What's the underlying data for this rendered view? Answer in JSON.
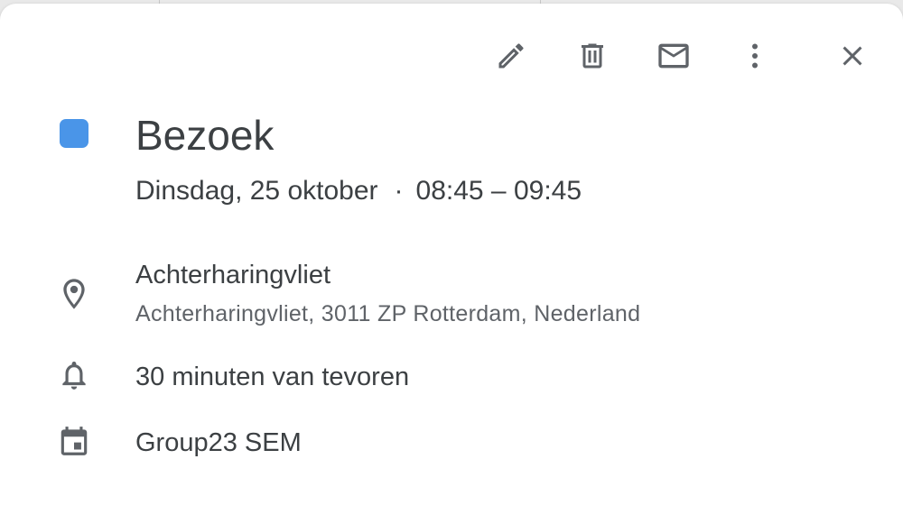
{
  "colors": {
    "event_color": "#4a95e8",
    "icon_color": "#5f6368",
    "text_primary": "#3c4043",
    "text_secondary": "#5f6368"
  },
  "toolbar": {
    "edit_icon": "pencil-icon",
    "delete_icon": "trash-icon",
    "email_icon": "mail-icon",
    "more_icon": "more-vert-icon",
    "close_icon": "close-icon"
  },
  "event": {
    "title": "Bezoek",
    "date": "Dinsdag, 25 oktober",
    "separator": "·",
    "time": "08:45 – 09:45",
    "location": {
      "icon": "location-pin-icon",
      "name": "Achterharingvliet",
      "address": "Achterharingvliet, 3011 ZP Rotterdam, Nederland"
    },
    "reminder": {
      "icon": "bell-icon",
      "text": "30 minuten van tevoren"
    },
    "calendar": {
      "icon": "calendar-icon",
      "name": "Group23 SEM"
    }
  }
}
